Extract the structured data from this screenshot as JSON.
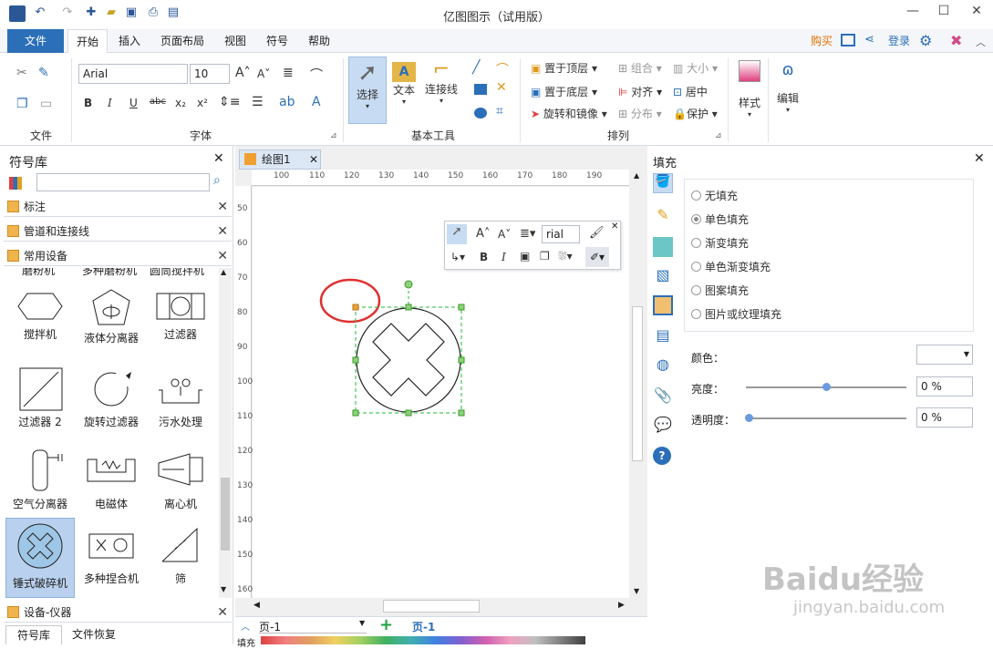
{
  "window": {
    "title": "亿图图示（试用版）"
  },
  "menu": {
    "file": "文件",
    "home": "开始",
    "insert": "插入",
    "layout": "页面布局",
    "view": "视图",
    "symbol": "符号",
    "help": "帮助",
    "buy": "购买",
    "login": "登录"
  },
  "ribbon": {
    "font_name": "Arial",
    "font_size": "10",
    "groups": {
      "file": "文件",
      "font": "字体",
      "basic_tools": "基本工具",
      "arrange": "排列"
    },
    "tools": {
      "select": "选择",
      "text": "文本",
      "connector": "连接线",
      "style": "样式",
      "edit": "编辑"
    },
    "arrange": {
      "bring_front": "置于顶层",
      "send_back": "置于底层",
      "rotate": "旋转和镜像",
      "group": "组合",
      "align": "对齐",
      "distribute": "分布",
      "size": "大小",
      "center": "居中",
      "protect": "保护"
    }
  },
  "library": {
    "title": "符号库",
    "sections": [
      "标注",
      "管道和连接线",
      "常用设备"
    ],
    "partial_top": [
      "磨粉机",
      "多种磨粉机",
      "圆筒搅拌机"
    ],
    "symbols": [
      [
        "搅拌机",
        "液体分离器",
        "过滤器"
      ],
      [
        "过滤器 2",
        "旋转过滤器",
        "污水处理"
      ],
      [
        "空气分离器",
        "电磁体",
        "离心机"
      ],
      [
        "锤式破碎机",
        "多种捏合机",
        "筛"
      ]
    ],
    "bottom_section": "设备-仪器",
    "tabs": [
      "符号库",
      "文件恢复"
    ]
  },
  "document": {
    "tab": "绘图1",
    "hruler": [
      "100",
      "110",
      "120",
      "130",
      "140",
      "150",
      "160",
      "170",
      "180",
      "190"
    ],
    "vruler": [
      "50",
      "60",
      "70",
      "80",
      "90",
      "100",
      "110",
      "120",
      "130",
      "140",
      "150",
      "160"
    ],
    "floating_font": "rial",
    "page_select": "页-1",
    "page_tab": "页-1",
    "fill_label": "填充"
  },
  "fill_panel": {
    "title": "填充",
    "options": [
      "无填充",
      "单色填充",
      "渐变填充",
      "单色渐变填充",
      "图案填充",
      "图片或纹理填充"
    ],
    "selected": 1,
    "color_label": "颜色：",
    "brightness_label": "亮度：",
    "brightness": "0 %",
    "transparency_label": "透明度：",
    "transparency": "0 %",
    "brightness_level": 0.5,
    "transparency_level": 0.0
  },
  "watermark": {
    "line1": "Baidu经验",
    "line2": "jingyan.baidu.com"
  },
  "colors": {
    "accent": "#2b6fb8",
    "selection": "#22bb33",
    "highlight_circle": "#e03030",
    "handle": "#f0a030"
  }
}
